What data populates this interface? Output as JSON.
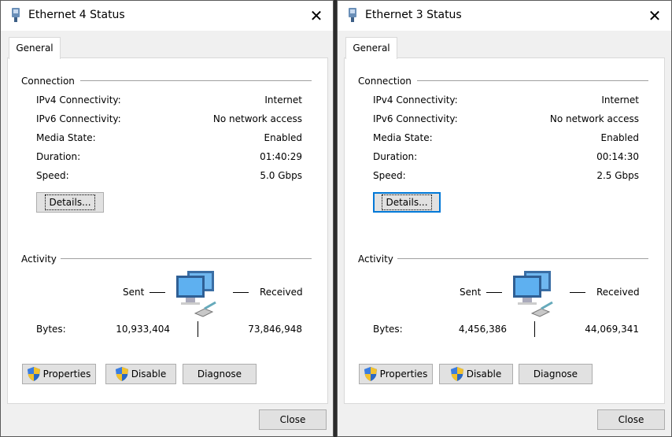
{
  "colors": {
    "accent": "#0078d7",
    "titlebar": "#ffffff",
    "window_bg": "#f0f0f0"
  },
  "dialogs": [
    {
      "title": "Ethernet 4 Status",
      "tab": "General",
      "connection_label": "Connection",
      "rows": [
        {
          "label": "IPv4 Connectivity:",
          "value": "Internet"
        },
        {
          "label": "IPv6 Connectivity:",
          "value": "No network access"
        },
        {
          "label": "Media State:",
          "value": "Enabled"
        },
        {
          "label": "Duration:",
          "value": "01:40:29"
        },
        {
          "label": "Speed:",
          "value": "5.0 Gbps"
        }
      ],
      "details_label": "Details...",
      "activity_label": "Activity",
      "sent_label": "Sent",
      "received_label": "Received",
      "bytes_label": "Bytes:",
      "bytes_sent": "10,933,404",
      "bytes_received": "73,846,948",
      "properties_label": "Properties",
      "disable_label": "Disable",
      "diagnose_label": "Diagnose",
      "close_label": "Close"
    },
    {
      "title": "Ethernet 3 Status",
      "tab": "General",
      "connection_label": "Connection",
      "rows": [
        {
          "label": "IPv4 Connectivity:",
          "value": "Internet"
        },
        {
          "label": "IPv6 Connectivity:",
          "value": "No network access"
        },
        {
          "label": "Media State:",
          "value": "Enabled"
        },
        {
          "label": "Duration:",
          "value": "00:14:30"
        },
        {
          "label": "Speed:",
          "value": "2.5 Gbps"
        }
      ],
      "details_label": "Details...",
      "activity_label": "Activity",
      "sent_label": "Sent",
      "received_label": "Received",
      "bytes_label": "Bytes:",
      "bytes_sent": "4,456,386",
      "bytes_received": "44,069,341",
      "properties_label": "Properties",
      "disable_label": "Disable",
      "diagnose_label": "Diagnose",
      "close_label": "Close"
    }
  ]
}
